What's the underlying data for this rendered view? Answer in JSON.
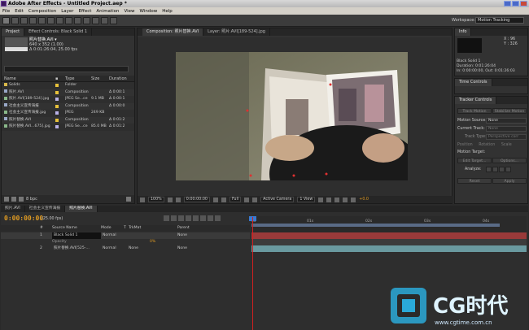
{
  "window": {
    "title": "Adobe After Effects - Untitled Project.aep *"
  },
  "menu": [
    "File",
    "Edit",
    "Composition",
    "Layer",
    "Effect",
    "Animation",
    "View",
    "Window",
    "Help"
  ],
  "workspace": {
    "label": "Workspace:",
    "value": "Motion Tracking"
  },
  "project_panel": {
    "tabs": [
      "Project",
      "Effect Controls: Black Solid 1"
    ],
    "selected_name": "照片替换.AVI ▾",
    "selected_info": [
      "640 x 352 (1.00)",
      "Δ 0:01:26:04, 25.00 fps"
    ],
    "columns": [
      "Name",
      "Type",
      "Size",
      "Duration"
    ],
    "rows": [
      {
        "name": "Solids",
        "tag": "#e8c23a",
        "type": "Folder",
        "size": "",
        "duration": "",
        "icon": "folder-icon"
      },
      {
        "name": "照片.AVI",
        "tag": "#e8c23a",
        "type": "Composition",
        "size": "",
        "duration": "Δ 0:00:1",
        "icon": "composition-icon"
      },
      {
        "name": "照片.AVI[189-524].jpg",
        "tag": "#b9b2e8",
        "type": "JPEG Se...ce",
        "size": "9.1 MB",
        "duration": "Δ 0:00:1",
        "icon": "image-sequence-icon"
      },
      {
        "name": "社会主义宣传海报",
        "tag": "#e8c23a",
        "type": "Composition",
        "size": "",
        "duration": "Δ 0:00:0",
        "icon": "composition-icon"
      },
      {
        "name": "社会主义宣传海报.jpg",
        "tag": "#b9b2e8",
        "type": "JPEG",
        "size": "249 KB",
        "duration": "",
        "icon": "image-icon"
      },
      {
        "name": "照片替换.AVI",
        "tag": "#e8c23a",
        "type": "Composition",
        "size": "",
        "duration": "Δ 0:01:2",
        "icon": "composition-icon"
      },
      {
        "name": "照片替换.AVI...675].jpg",
        "tag": "#b9b2e8",
        "type": "JPEG Se...ce",
        "size": "85.0 MB",
        "duration": "Δ 0:01:2",
        "icon": "image-sequence-icon"
      }
    ],
    "footer_bpc": "8 bpc"
  },
  "viewer": {
    "tabs": [
      "Composition: 照片替换.AVI",
      "Layer: 照片.AVI[189-524].jpg"
    ],
    "footer": {
      "zoom": "100%",
      "timecode": "0:00:00:00",
      "resolution": "Full",
      "camera": "Active Camera",
      "views": "1 View",
      "exposure": "+0.0"
    }
  },
  "info_panel": {
    "tab": "Info",
    "readout": [
      "X : 96",
      "Y : 326"
    ],
    "layer_name": "Black Solid 1",
    "lines": [
      "Duration: 0:01:26:04",
      "In: 0:00:00:00, Out: 0:01:26:03"
    ]
  },
  "time_controls": {
    "tab": "Time Controls"
  },
  "tracker_panel": {
    "tab": "Tracker Controls",
    "buttons_top": [
      "Track Motion",
      "Stabilize Motion"
    ],
    "motion_source_label": "Motion Source:",
    "motion_source_value": "None",
    "current_track_label": "Current Track:",
    "current_track_value": "None",
    "track_type_label": "Track Type:",
    "track_type_value": "Perspective corr",
    "checks": [
      "Position",
      "Rotation",
      "Scale"
    ],
    "motion_target_label": "Motion Target:",
    "buttons_mid": [
      "Edit Target...",
      "Options..."
    ],
    "analyze_label": "Analyze:",
    "buttons_bottom": [
      "Reset",
      "Apply"
    ]
  },
  "timeline": {
    "tabs": [
      "照片.AVI",
      "社会主义宣传海报",
      "照片替换.AVI"
    ],
    "timecode": "0:00:00:00",
    "fps": "(25.00 fps)",
    "columns": [
      "#",
      "Source Name",
      "Mode",
      "T",
      "TrkMat",
      "Parent"
    ],
    "layers": [
      {
        "num": "1",
        "name": "Black Solid 1",
        "mode": "Normal",
        "trkmat": "",
        "parent": "None",
        "color": "#c83a3a"
      },
      {
        "num": "",
        "name": "Opacity",
        "mode": "",
        "trkmat": "",
        "parent": "",
        "color": "",
        "value": "0%"
      },
      {
        "num": "2",
        "name": "照片替换.AVI[525-...",
        "mode": "Normal",
        "trkmat": "None",
        "parent": "None",
        "color": "#7ab0c8"
      }
    ],
    "ruler_ticks": [
      "0s",
      "01s",
      "02s",
      "03s",
      "04s"
    ]
  },
  "watermark": {
    "brand": "CG时代",
    "url": "www.cgtime.com.cn"
  },
  "colors": {
    "accent_timecode": "#e09b22",
    "playhead": "#d02020",
    "layer1_bar": "#9a3a3a",
    "layer2_bar": "#6a9aa0"
  }
}
